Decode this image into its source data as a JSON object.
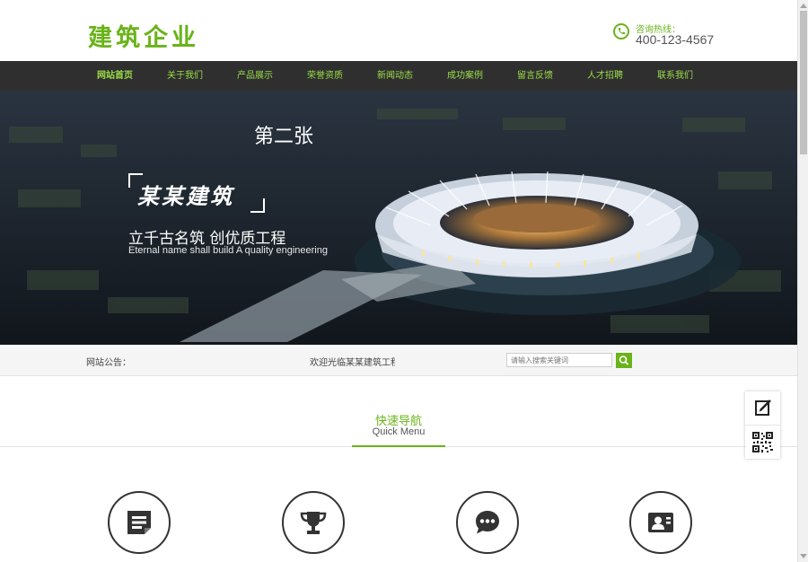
{
  "header": {
    "logo": "建筑企业",
    "hotline_label": "咨询热线：",
    "hotline_number": "400-123-4567"
  },
  "nav": {
    "items": [
      "网站首页",
      "关于我们",
      "产品展示",
      "荣誉资质",
      "新闻动态",
      "成功案例",
      "留言反馈",
      "人才招聘",
      "联系我们"
    ],
    "active_index": 0
  },
  "banner": {
    "slide_title": "第二张",
    "brand": "某某建筑",
    "slogan": "立千古名筑 创优质工程",
    "slogan_en": "Eternal name shall build A quality engineering"
  },
  "notice": {
    "label": "网站公告：",
    "message": "欢迎光临某某建筑工程",
    "search_placeholder": "请输入搜索关键词"
  },
  "quick_menu": {
    "title": "快速导航",
    "subtitle": "Quick Menu",
    "icons": [
      "document-icon",
      "trophy-icon",
      "chat-icon",
      "id-card-icon"
    ]
  },
  "side_float": {
    "icons": [
      "edit-icon",
      "qr-code-icon"
    ]
  },
  "colors": {
    "accent": "#6ab31a",
    "nav_bg": "#2f2f2f",
    "nav_text": "#9ddc4a"
  }
}
